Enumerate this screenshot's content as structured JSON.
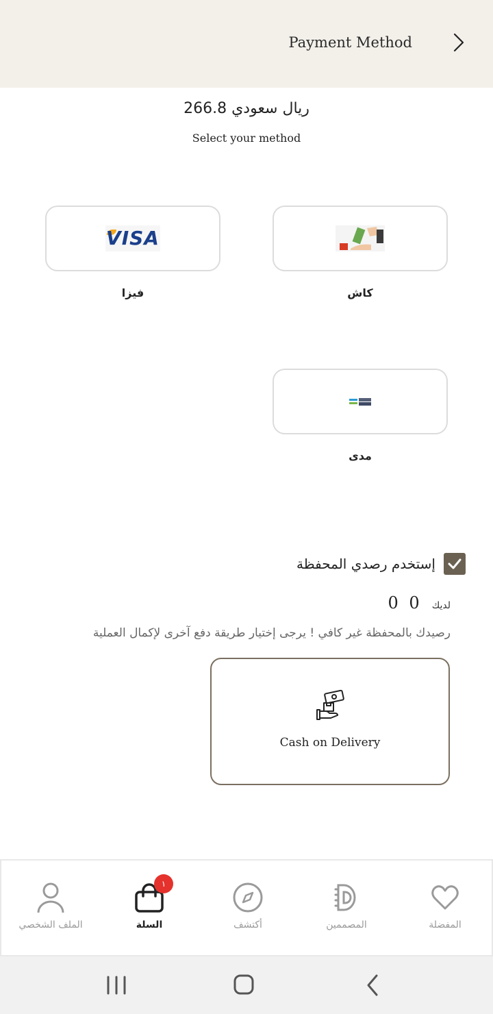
{
  "header": {
    "title": "Payment Method",
    "back_icon": "chevron-right-icon"
  },
  "summary": {
    "amount": "266.8 ريال سعودي",
    "instruction": "Select your method"
  },
  "methods": [
    {
      "label": "كاش",
      "logo": "cash-icon"
    },
    {
      "label": "فيزا",
      "logo_text": "VISA"
    },
    {
      "label": "مدى",
      "logo": "mada-logo"
    }
  ],
  "wallet": {
    "use_label": "إستخدم رصدي المحفظة",
    "checked": true,
    "balance_label": "لديك",
    "balance_value": "0 0",
    "warning": "رصيدك بالمحفظة غير كافي ! يرجى إختيار طريقة دفع آخرى لإكمال العملية"
  },
  "cod": {
    "label": "Cash on Delivery",
    "icon": "cash-in-hand-icon"
  },
  "bottom_nav": {
    "items": [
      {
        "label": "المفضلة",
        "icon": "heart-icon"
      },
      {
        "label": "المصممين",
        "icon": "designers-icon"
      },
      {
        "label": "أكتشف",
        "icon": "compass-icon"
      },
      {
        "label": "السلة",
        "icon": "bag-icon",
        "badge": "١",
        "active": true
      },
      {
        "label": "الملف الشخصي",
        "icon": "user-icon"
      }
    ]
  },
  "colors": {
    "header_bg": "#f3f0ea",
    "accent": "#6b6153",
    "badge": "#e5322d"
  }
}
